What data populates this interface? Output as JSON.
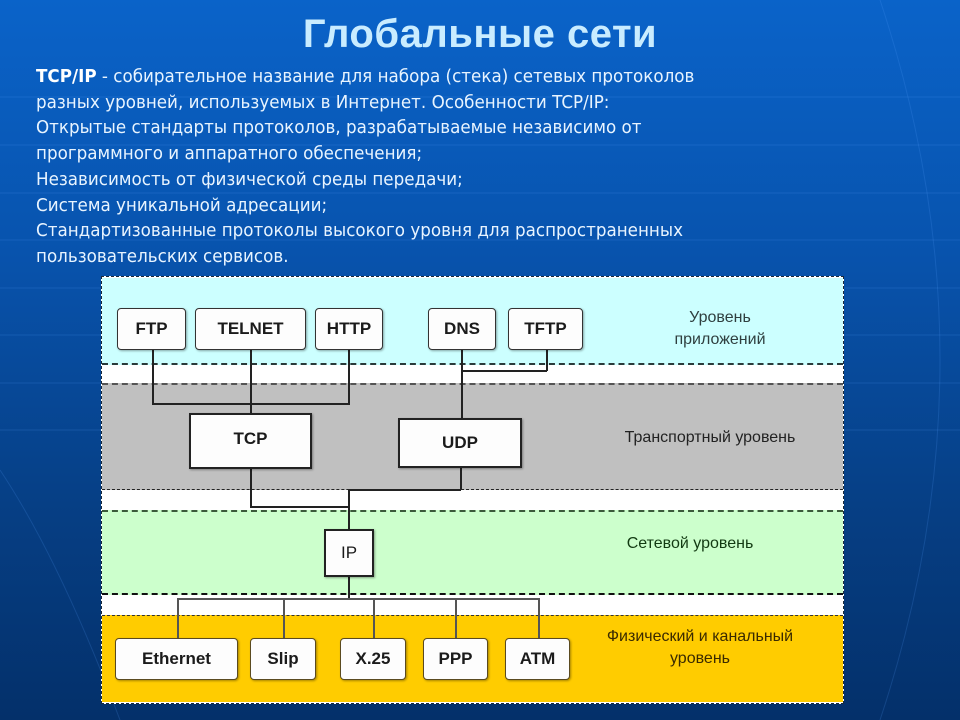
{
  "slide": {
    "title": "Глобальные сети",
    "description": {
      "term": "TCP/IP",
      "lines": [
        " - собирательное название для набора (стека) сетевых протоколов",
        "разных уровней, используемых в Интернет. Особенности TCP/IP:",
        "Открытые стандарты протоколов, разрабатываемые независимо от",
        "программного и аппаратного обеспечения;",
        "Независимость от физической среды передачи;",
        "Система уникальной адресации;",
        "Стандартизованные протоколы высокого уровня для распространенных",
        "пользовательских сервисов."
      ]
    }
  },
  "diagram": {
    "layers": {
      "application": {
        "label_line1": "Уровень",
        "label_line2": "приложений",
        "color": "#ccffff"
      },
      "transport": {
        "label": "Транспортный уровень",
        "color": "#c0c0c0"
      },
      "network": {
        "label": "Сетевой уровень",
        "color": "#ccffcc"
      },
      "physical": {
        "label_line1": "Физический и канальный",
        "label_line2": "уровень",
        "color": "#ffcc00"
      }
    },
    "protocols": {
      "ftp": "FTP",
      "telnet": "TELNET",
      "http": "HTTP",
      "dns": "DNS",
      "tftp": "TFTP",
      "tcp": "TCP",
      "udp": "UDP",
      "ip": "IP",
      "ethernet": "Ethernet",
      "slip": "Slip",
      "x25": "X.25",
      "ppp": "PPP",
      "atm": "ATM"
    }
  }
}
